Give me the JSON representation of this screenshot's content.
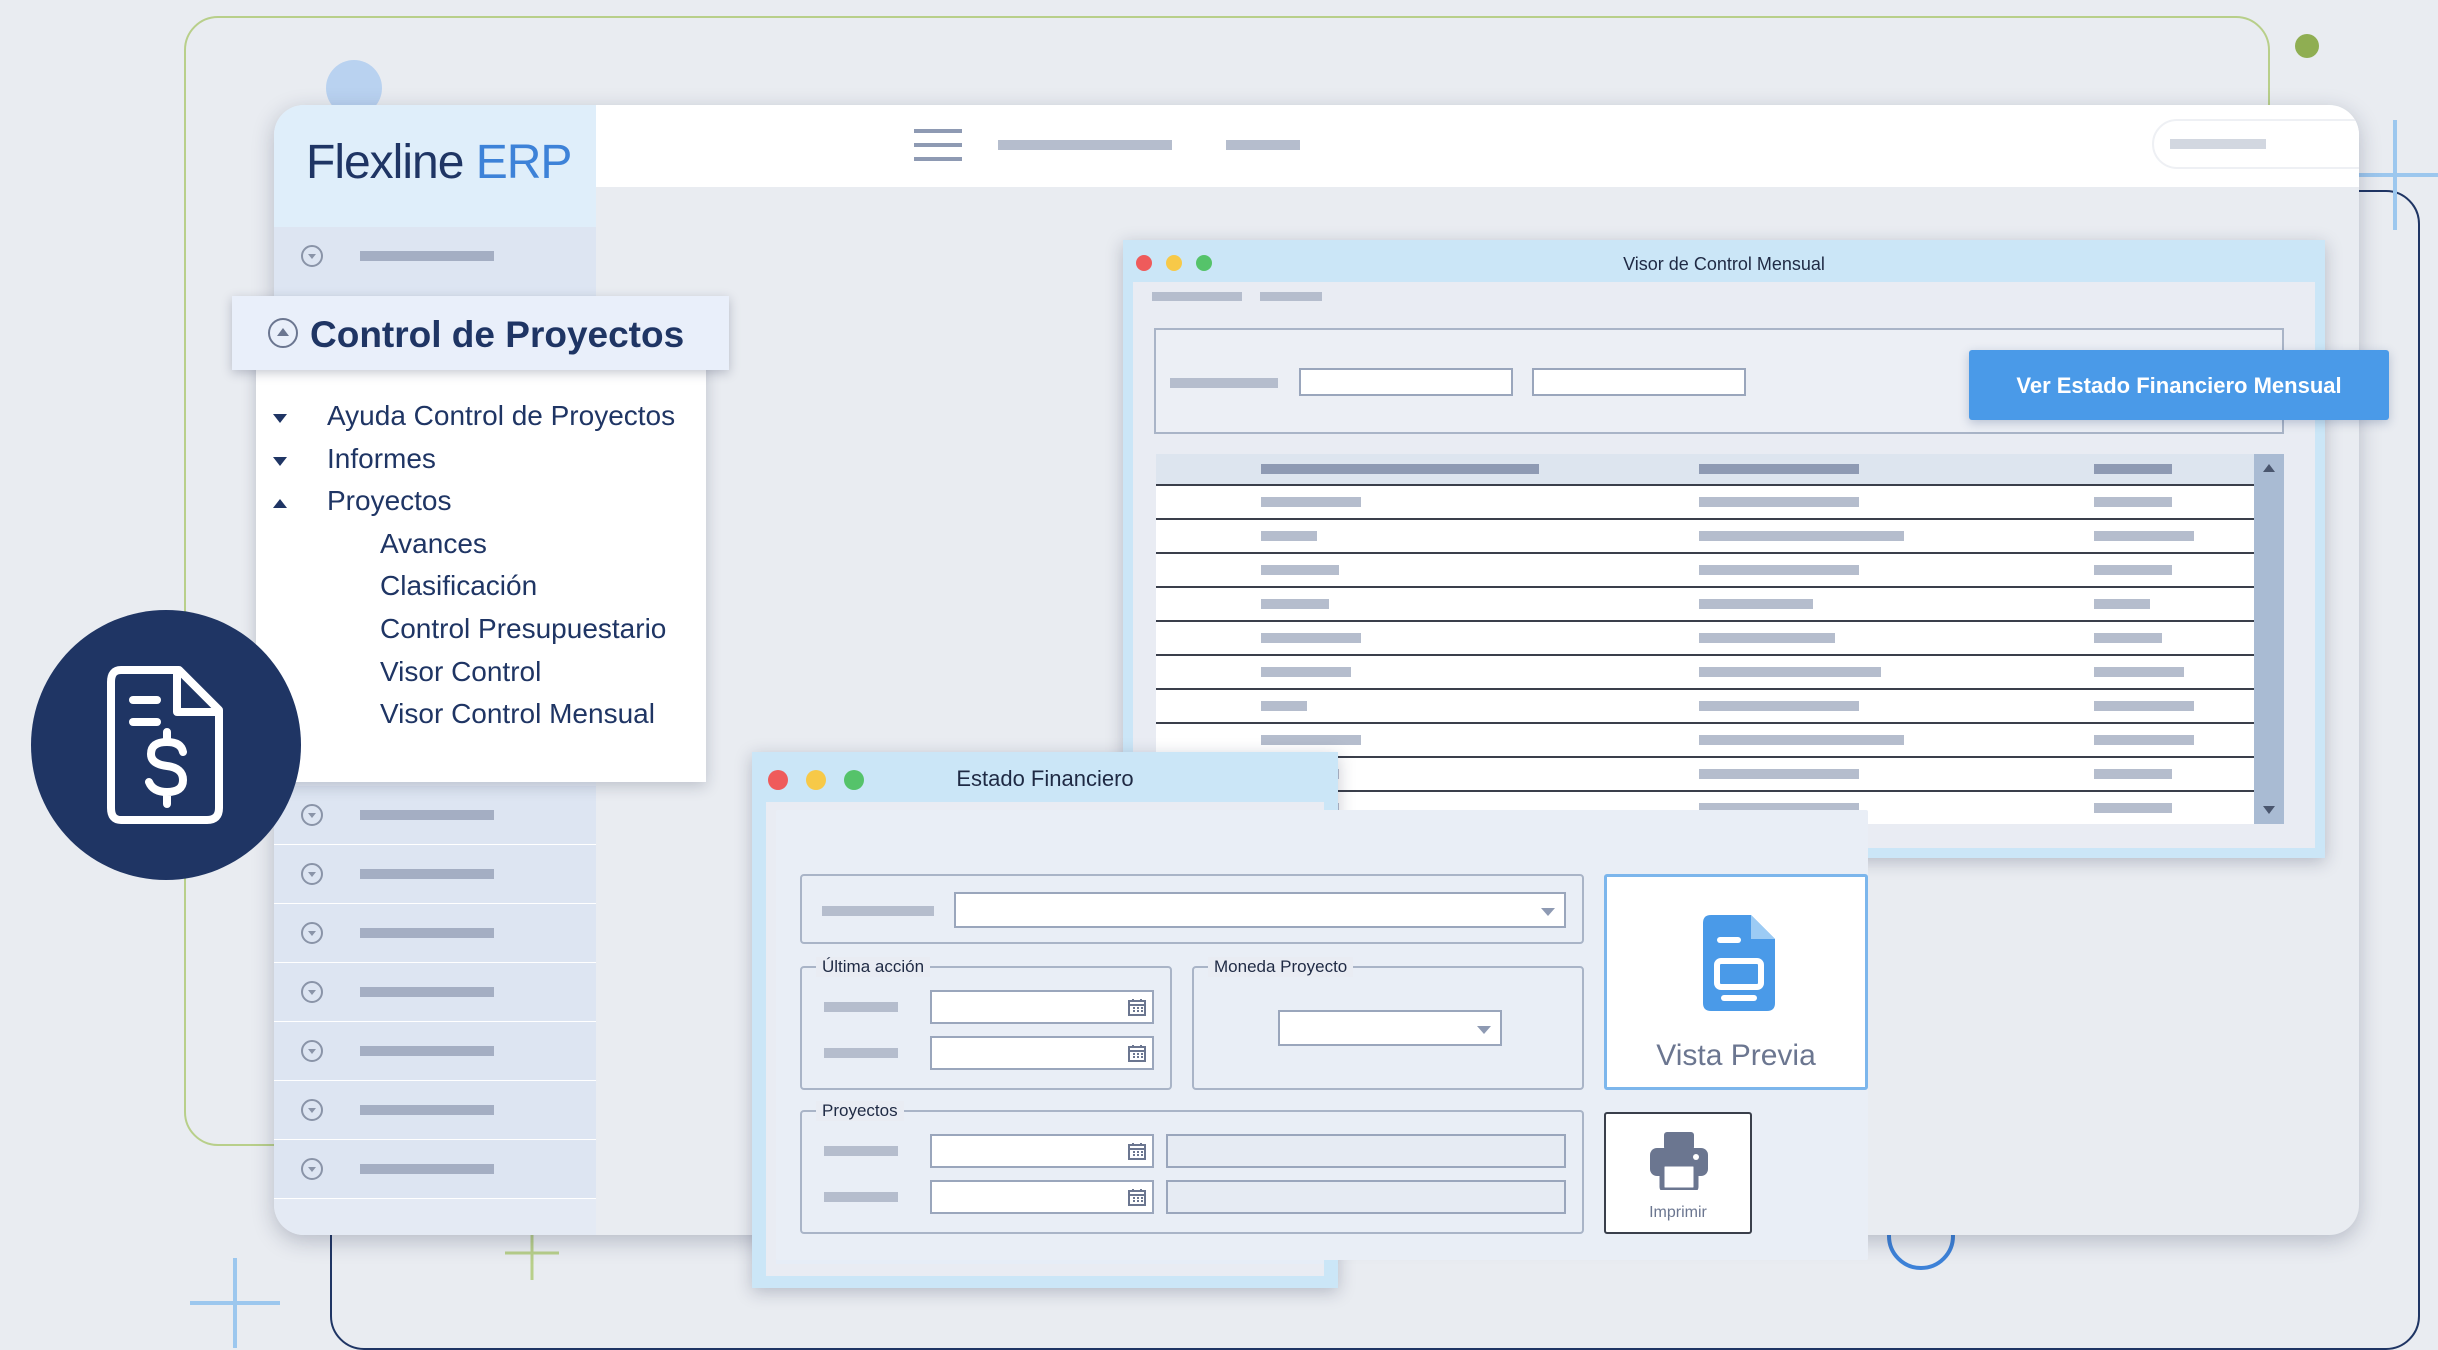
{
  "app": {
    "brand": "Flexline",
    "brand_suffix": "ERP"
  },
  "menu_popup": {
    "title": "Control de Proyectos",
    "items": [
      {
        "label": "Ayuda Control de Proyectos",
        "arrow": "down",
        "level": 1
      },
      {
        "label": "Informes",
        "arrow": "down",
        "level": 1
      },
      {
        "label": "Proyectos",
        "arrow": "up",
        "level": 1
      },
      {
        "label": "Avances",
        "level": 2
      },
      {
        "label": "Clasificación",
        "level": 2
      },
      {
        "label": "Control Presupuestario",
        "level": 2
      },
      {
        "label": "Visor Control",
        "level": 2
      },
      {
        "label": "Visor Control Mensual",
        "level": 2
      }
    ]
  },
  "visor_window": {
    "title": "Visor de Control Mensual",
    "action_button": "Ver Estado Financiero Mensual"
  },
  "estado_window": {
    "title": "Estado Financiero",
    "group_ultima": "Última acción",
    "group_moneda": "Moneda Proyecto",
    "group_proyectos": "Proyectos",
    "preview_label": "Vista Previa",
    "print_label": "Imprimir"
  },
  "icons": {
    "badge": "invoice-dollar-icon",
    "menu": "hamburger-icon",
    "preview": "document-preview-icon",
    "print": "printer-icon"
  },
  "colors": {
    "navy": "#1f3564",
    "accent": "#4a9ae8",
    "window": "#cbe6f7"
  }
}
